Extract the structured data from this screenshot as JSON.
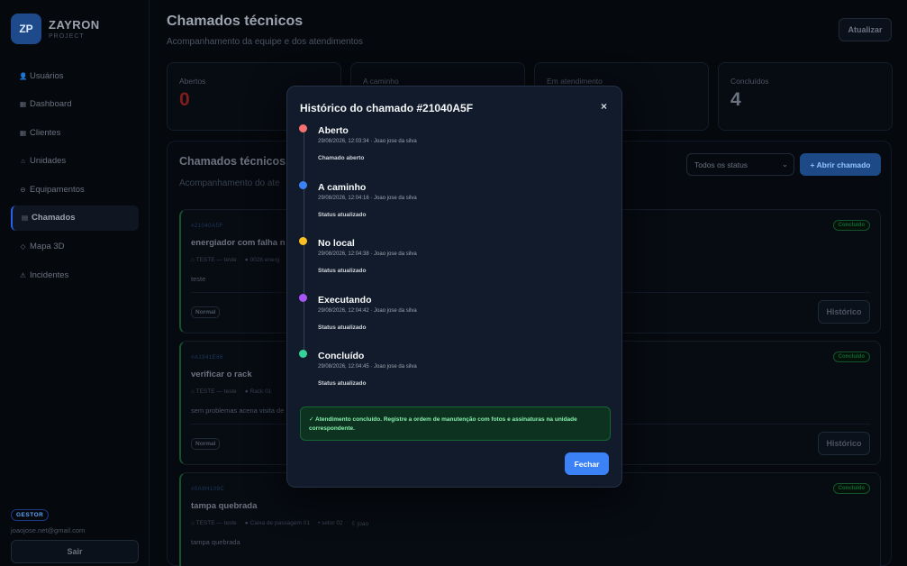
{
  "brand": {
    "initials": "ZP",
    "name": "ZAYRON",
    "sub": "PROJECT"
  },
  "sidebar": {
    "items": [
      {
        "label": "Usuários",
        "icon": "user-icon",
        "glyph": "👤"
      },
      {
        "label": "Dashboard",
        "icon": "dashboard-icon",
        "glyph": "▦"
      },
      {
        "label": "Clientes",
        "icon": "building-icon",
        "glyph": "▦"
      },
      {
        "label": "Unidades",
        "icon": "location-icon",
        "glyph": "⌂"
      },
      {
        "label": "Equipamentos",
        "icon": "equipment-icon",
        "glyph": "⊖"
      },
      {
        "label": "Chamados",
        "icon": "ticket-icon",
        "glyph": "▤"
      },
      {
        "label": "Mapa 3D",
        "icon": "map-icon",
        "glyph": "◇"
      },
      {
        "label": "Incidentes",
        "icon": "warning-icon",
        "glyph": "⚠"
      }
    ],
    "active_index": 5,
    "role": "GESTOR",
    "email": "joaojose.net@gmail.com",
    "logout": "Sair"
  },
  "header": {
    "title": "Chamados técnicos",
    "subtitle": "Acompanhamento da equipe e dos atendimentos",
    "refresh": "Atualizar"
  },
  "stats": [
    {
      "label": "Abertos",
      "value": "0",
      "color": "#7f1d1d"
    },
    {
      "label": "A caminho",
      "value": "",
      "color": "#4b5563"
    },
    {
      "label": "Em atendimento",
      "value": "",
      "color": "#4b5563"
    },
    {
      "label": "Concluídos",
      "value": "4",
      "color": "#6b7280"
    }
  ],
  "panel": {
    "title": "Chamados técnicos",
    "subtitle": "Acompanhamento do ate",
    "filter": "Todos os status",
    "open_button": "+ Abrir chamado"
  },
  "tickets": [
    {
      "code": "#21040A5F",
      "title": "energiador com falha n",
      "meta": [
        "⌂ TESTE — teste",
        "● 0026 energ"
      ],
      "desc": "teste",
      "priority": "Normal",
      "status": "Concluído",
      "history": "Histórico"
    },
    {
      "code": "#A1941E68",
      "title": "verificar o rack",
      "meta": [
        "⌂ TESTE — teste",
        "● Rack 01"
      ],
      "desc": "sem problemas acena visita de",
      "priority": "Normal",
      "status": "Concluído",
      "history": "Histórico"
    },
    {
      "code": "#0A9H109C",
      "title": "tampa quebrada",
      "meta": [
        "⌂ TESTE — teste",
        "● Caixa de passagem 01",
        "• setor 02",
        "⇩ joao"
      ],
      "desc": "tampa quebrada",
      "priority": "",
      "status": "Concluído",
      "history": ""
    }
  ],
  "modal": {
    "title": "Histórico do chamado #21040A5F",
    "close": "×",
    "events": [
      {
        "title": "Aberto",
        "meta": "29/08/2026, 12:03:34 · Joao jose da silva",
        "note": "Chamado aberto",
        "color": "#f87171"
      },
      {
        "title": "A caminho",
        "meta": "29/08/2026, 12:04:16 · Joao jose da silva",
        "note": "Status atualizado",
        "color": "#3b82f6"
      },
      {
        "title": "No local",
        "meta": "29/08/2026, 12:04:38 · Joao jose da silva",
        "note": "Status atualizado",
        "color": "#fbbf24"
      },
      {
        "title": "Executando",
        "meta": "29/08/2026, 12:04:42 · Joao jose da silva",
        "note": "Status atualizado",
        "color": "#a855f7"
      },
      {
        "title": "Concluído",
        "meta": "29/08/2026, 12:04:45 · Joao jose da silva",
        "note": "Status atualizado",
        "color": "#34d399"
      }
    ],
    "alert": "✓ Atendimento concluído. Registre a ordem de manutenção com fotos e assinaturas na unidade correspondente.",
    "close_button": "Fechar"
  }
}
